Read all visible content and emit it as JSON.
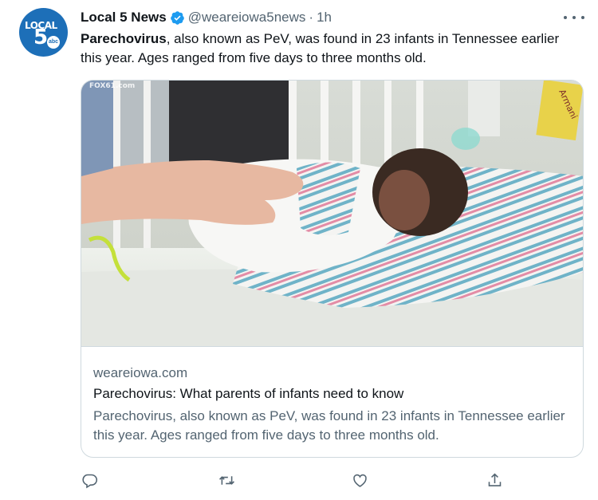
{
  "tweet": {
    "display_name": "Local 5 News",
    "handle": "@weareiowa5news",
    "separator": "·",
    "time": "1h",
    "text_bold": "Parechovirus",
    "text_rest": ", also known as PeV, was found in 23 infants in Tennessee earlier this year. Ages ranged from five days to three months old."
  },
  "avatar": {
    "logo_line1": "LOCAL",
    "logo_line2": "5",
    "logo_badge": "abc"
  },
  "card": {
    "image_watermark": "FOX61.com",
    "image_nametag": "Armani",
    "domain": "weareiowa.com",
    "title": "Parechovirus: What parents of infants need to know",
    "description": "Parechovirus, also known as PeV, was found in 23 infants in Tennessee earlier this year. Ages ranged from five days to three months old."
  },
  "icons": {
    "verified": "verified-badge-icon",
    "more": "more-options-icon",
    "reply": "reply-icon",
    "retweet": "retweet-icon",
    "like": "like-icon",
    "share": "share-icon"
  },
  "colors": {
    "brand_blue": "#1d9bf0",
    "avatar_blue": "#1d6fb8",
    "text_primary": "#0f1419",
    "text_secondary": "#536471",
    "border": "#cfd9de"
  }
}
